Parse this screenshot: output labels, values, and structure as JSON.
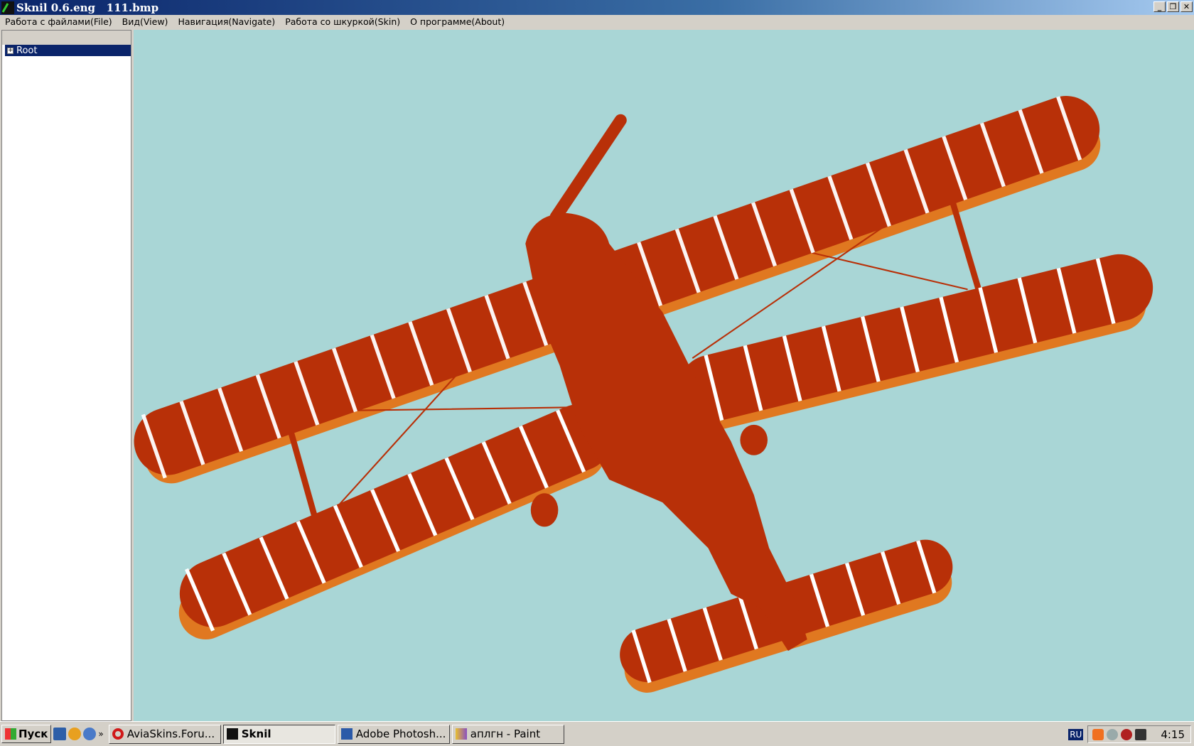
{
  "window": {
    "title": "Sknil 0.6.eng   111.bmp",
    "minimize": "_",
    "restore": "❐",
    "close": "✕"
  },
  "menu": [
    "Работа с файлами(File)",
    "Вид(View)",
    "Навигация(Navigate)",
    "Работа со шкуркой(Skin)",
    "О программе(About)"
  ],
  "tree": {
    "root_label": "Root",
    "expander": "+"
  },
  "viewport": {
    "background": "#a9d6d6",
    "model_color": "#b83008",
    "underside_color": "#e07820"
  },
  "taskbar": {
    "start_label": "Пуск",
    "chevron": "»",
    "tasks": [
      {
        "label": "AviaSkins.Foru...",
        "icon": "opera-icon"
      },
      {
        "label": "Sknil",
        "icon": "sknil-icon",
        "active": true
      },
      {
        "label": "Adobe Photosh...",
        "icon": "photoshop-icon"
      },
      {
        "label": "аплгн - Paint",
        "icon": "paint-icon"
      }
    ],
    "lang": "RU",
    "clock": "4:15"
  }
}
